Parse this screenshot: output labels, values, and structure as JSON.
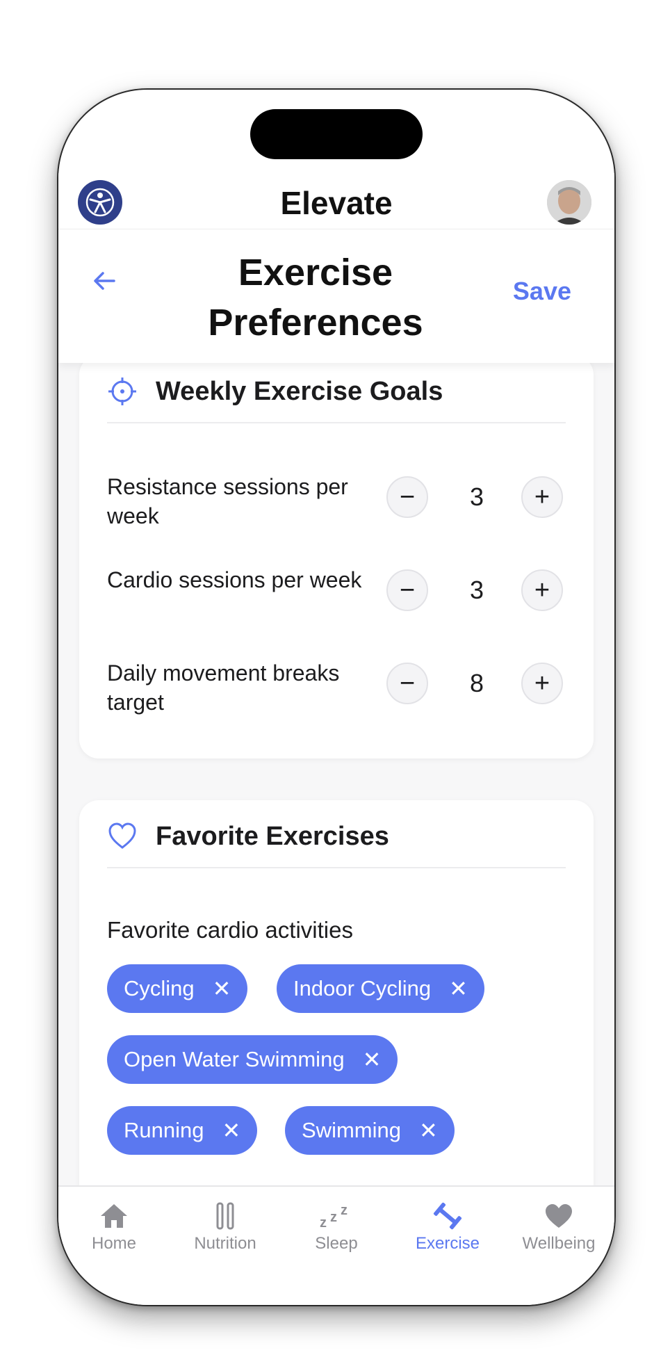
{
  "app": {
    "title": "Elevate"
  },
  "header": {
    "title": "Exercise Preferences",
    "save_label": "Save"
  },
  "goals_card": {
    "title": "Weekly Exercise Goals",
    "rows": [
      {
        "label": "Resistance sessions per week",
        "value": "3"
      },
      {
        "label": "Cardio sessions per week",
        "value": "3"
      },
      {
        "label": "Daily movement breaks target",
        "value": "8"
      }
    ],
    "minus_symbol": "−",
    "plus_symbol": "+"
  },
  "favorites_card": {
    "title": "Favorite Exercises",
    "cardio_label": "Favorite cardio activities",
    "chips": [
      "Cycling",
      "Indoor Cycling",
      "Open Water Swimming",
      "Running",
      "Swimming"
    ],
    "remove_symbol": "✕"
  },
  "tabs": [
    {
      "label": "Home",
      "icon": "home-icon"
    },
    {
      "label": "Nutrition",
      "icon": "utensils-icon"
    },
    {
      "label": "Sleep",
      "icon": "zzz-icon"
    },
    {
      "label": "Exercise",
      "icon": "dumbbell-icon",
      "active": true
    },
    {
      "label": "Wellbeing",
      "icon": "heart-icon"
    }
  ],
  "colors": {
    "accent": "#5b78f0",
    "logo_bg": "#2f3f8a",
    "inactive_tab": "#8e8e93"
  }
}
